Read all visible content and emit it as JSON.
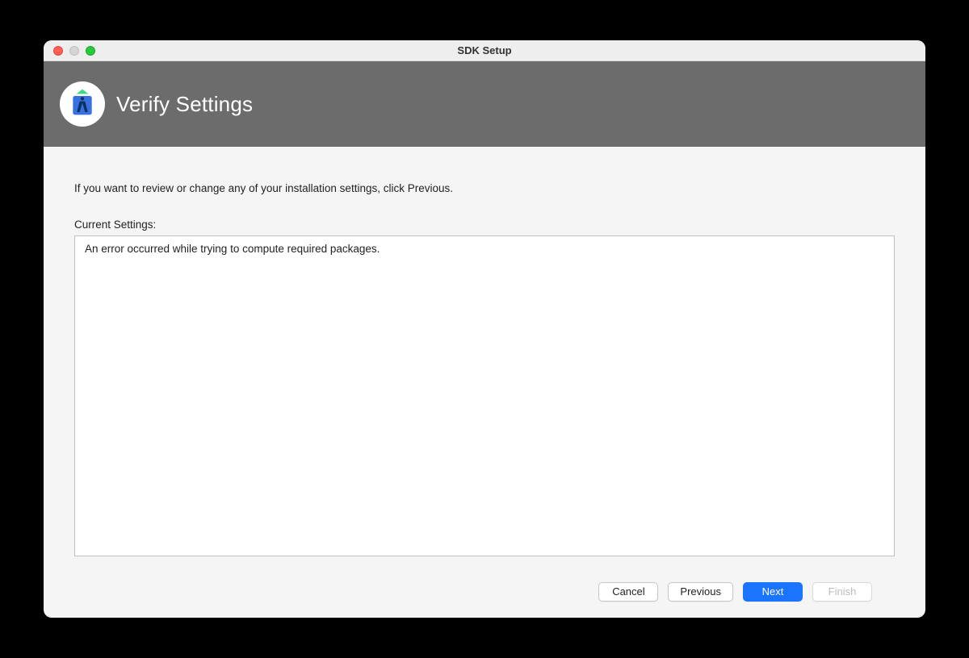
{
  "window": {
    "title": "SDK Setup"
  },
  "banner": {
    "title": "Verify Settings"
  },
  "content": {
    "intro": "If you want to review or change any of your installation settings, click Previous.",
    "section_label": "Current Settings:",
    "settings_message": "An error occurred while trying to compute required packages."
  },
  "footer": {
    "cancel": "Cancel",
    "previous": "Previous",
    "next": "Next",
    "finish": "Finish"
  }
}
